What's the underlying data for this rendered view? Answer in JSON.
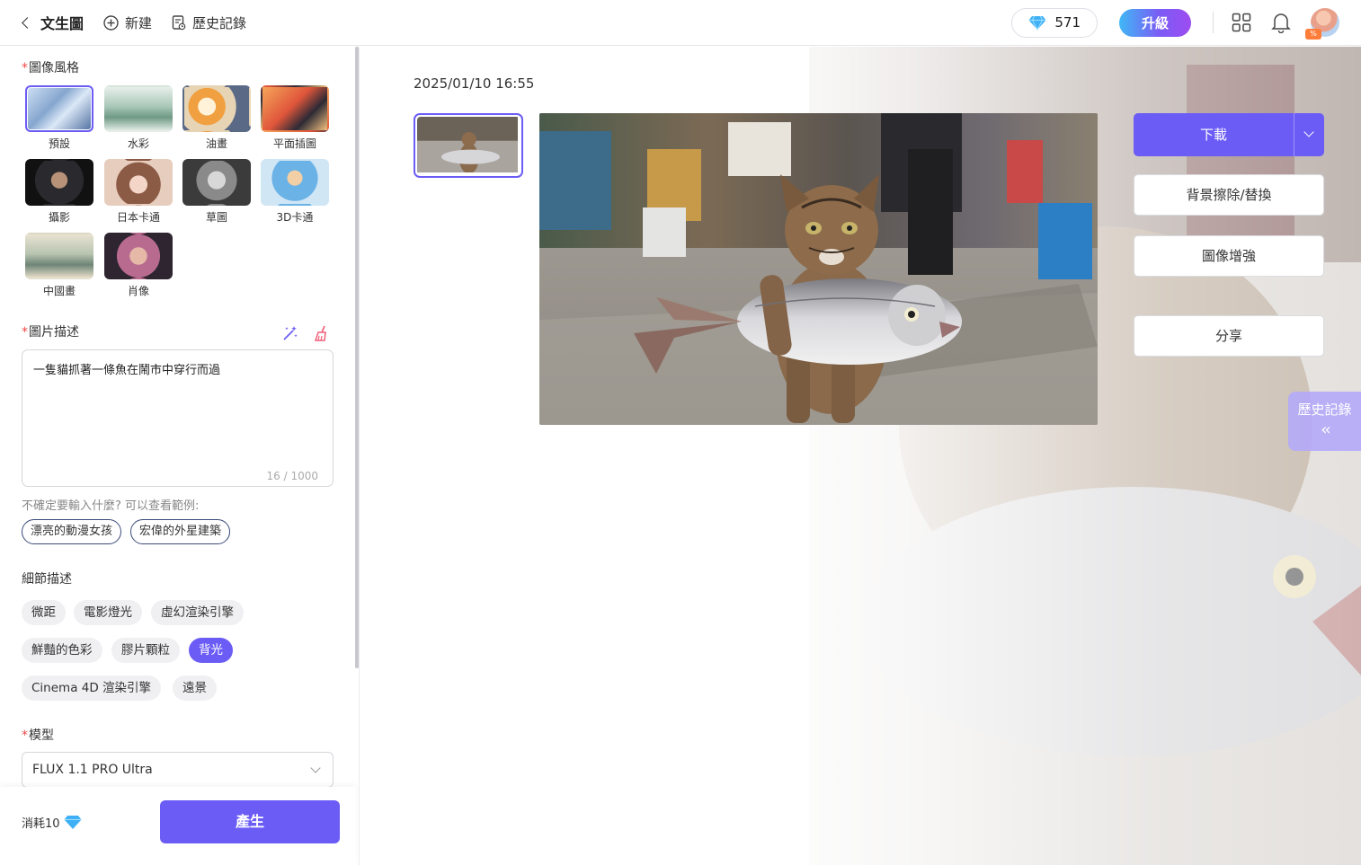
{
  "header": {
    "back_label": "文生圖",
    "new_label": "新建",
    "history_label": "歷史記錄",
    "credits": "571",
    "upgrade_label": "升級"
  },
  "left": {
    "style_label": "圖像風格",
    "styles": [
      {
        "label": "預設",
        "selected": true
      },
      {
        "label": "水彩"
      },
      {
        "label": "油畫"
      },
      {
        "label": "平面插圖"
      },
      {
        "label": "攝影"
      },
      {
        "label": "日本卡通"
      },
      {
        "label": "草圖"
      },
      {
        "label": "3D卡通"
      },
      {
        "label": "中國畫"
      },
      {
        "label": "肖像"
      }
    ],
    "prompt_label": "圖片描述",
    "prompt_value": "一隻貓抓著一條魚在鬧市中穿行而過",
    "prompt_counter": "16 / 1000",
    "hint": "不確定要輸入什麼? 可以查看範例:",
    "examples": [
      "漂亮的動漫女孩",
      "宏偉的外星建築"
    ],
    "detail_label": "細節描述",
    "details": [
      {
        "label": "微距"
      },
      {
        "label": "電影燈光"
      },
      {
        "label": "虛幻渲染引擎"
      },
      {
        "label": "鮮豔的色彩"
      },
      {
        "label": "膠片顆粒"
      },
      {
        "label": "背光",
        "active": true
      },
      {
        "label": "Cinema 4D 渲染引擎"
      },
      {
        "label": "遠景"
      }
    ],
    "model_label": "模型",
    "model_value": "FLUX 1.1 PRO Ultra",
    "cost_label": "消耗10",
    "generate_label": "產生"
  },
  "main": {
    "timestamp": "2025/01/10 16:55",
    "download_label": "下載",
    "bg_remove_label": "背景擦除/替換",
    "enhance_label": "圖像增強",
    "share_label": "分享",
    "history_tab_label": "歷史記錄"
  },
  "colors": {
    "accent": "#6b5cf6",
    "required": "#f04848"
  }
}
